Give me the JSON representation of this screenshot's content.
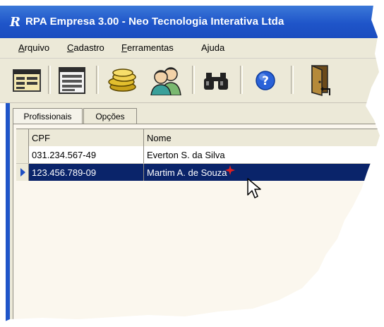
{
  "window": {
    "title": "RPA Empresa 3.00 - Neo Tecnologia Interativa Ltda",
    "app_icon": "R"
  },
  "menu": [
    {
      "label": "Arquivo",
      "mnemonic": "A",
      "rest": "rquivo"
    },
    {
      "label": "Cadastro",
      "mnemonic": "C",
      "rest": "adastro"
    },
    {
      "label": "Ferramentas",
      "mnemonic": "F",
      "rest": "erramentas"
    },
    {
      "label": "Ajuda",
      "mnemonic": "",
      "rest": "Ajuda"
    }
  ],
  "toolbar": {
    "icons": [
      "card-form-icon",
      "grid-form-icon",
      "coins-stack-icon",
      "users-icon",
      "binoculars-icon",
      "help-icon",
      "exit-door-icon"
    ]
  },
  "tabs": [
    {
      "label": "Profissionais",
      "active": true
    },
    {
      "label": "Opções",
      "active": false
    }
  ],
  "grid": {
    "columns": [
      "CPF",
      "Nome"
    ],
    "rows": [
      {
        "cpf": "031.234.567-49",
        "nome": "Everton S. da Silva",
        "selected": false
      },
      {
        "cpf": "123.456.789-09",
        "nome": "Martim A. de Souza",
        "selected": true
      }
    ]
  },
  "colors": {
    "titlebar": "#1f55c9",
    "selection": "#0a246a",
    "chrome": "#ece9d8"
  }
}
